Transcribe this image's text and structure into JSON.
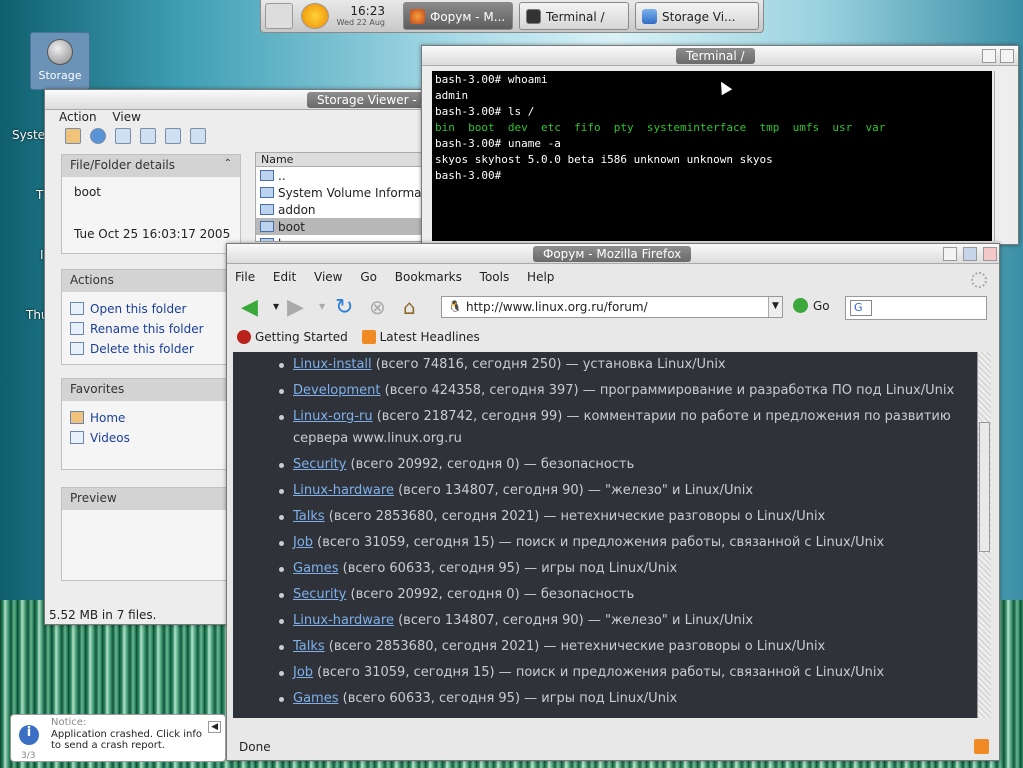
{
  "taskbar": {
    "clock_time": "16:23",
    "clock_date": "Wed 22 Aug",
    "tasks": [
      "Форум - М...",
      "Terminal /",
      "Storage Vi..."
    ]
  },
  "desktop": {
    "storage_icon_label": "Storage",
    "partial_labels": [
      "Syste",
      "T",
      "I",
      "Thu"
    ]
  },
  "storage_viewer": {
    "title": "Storage Viewer - /",
    "menu": [
      "Action",
      "View"
    ],
    "details_header": "File/Folder details",
    "details_name": "boot",
    "details_date": "Tue Oct 25 16:03:17 2005",
    "actions_header": "Actions",
    "actions": [
      "Open this folder",
      "Rename this folder",
      "Delete this folder"
    ],
    "favorites_header": "Favorites",
    "favorites": [
      "Home",
      "Videos"
    ],
    "preview_header": "Preview",
    "list_header": "Name",
    "files": [
      "..",
      "System Volume Informat",
      "addon",
      "boot",
      "b"
    ],
    "status": "5.52 MB in 7 files."
  },
  "terminal": {
    "title": "Terminal /",
    "lines": [
      "bash-3.00# whoami",
      "admin",
      "bash-3.00# ls /",
      "bin  boot  dev  etc  fifo  pty  systeminterface  tmp  umfs  usr  var",
      "bash-3.00# uname -a",
      "skyos skyhost 5.0.0 beta i586 unknown unknown skyos",
      "bash-3.00#"
    ]
  },
  "firefox": {
    "title": "Форум - Mozilla Firefox",
    "menu": [
      "File",
      "Edit",
      "View",
      "Go",
      "Bookmarks",
      "Tools",
      "Help"
    ],
    "url": "http://www.linux.org.ru/forum/",
    "go_label": "Go",
    "bookmarks": [
      "Getting Started",
      "Latest Headlines"
    ],
    "status": "Done",
    "forums": [
      {
        "name": "Linux-install",
        "desc": " (всего 74816, сегодня 250) — установка Linux/Unix"
      },
      {
        "name": "Development",
        "desc": " (всего 424358, сегодня 397) — программирование и разработка ПО под Linux/Unix"
      },
      {
        "name": "Linux-org-ru",
        "desc": " (всего 218742, сегодня 99) — комментарии по работе и предложения по развитию сервера www.linux.org.ru"
      },
      {
        "name": "Security",
        "desc": " (всего 20992, сегодня 0) — безопасность"
      },
      {
        "name": "Linux-hardware",
        "desc": " (всего 134807, сегодня 90) — \"железо\" и Linux/Unix"
      },
      {
        "name": "Talks",
        "desc": " (всего 2853680, сегодня 2021) — нетехнические разговоры о Linux/Unix"
      },
      {
        "name": "Job",
        "desc": " (всего 31059, сегодня 15) — поиск и предложения работы, связанной с Linux/Unix"
      },
      {
        "name": "Games",
        "desc": " (всего 60633, сегодня 95) — игры под Linux/Unix"
      },
      {
        "name": "Security",
        "desc": " (всего 20992, сегодня 0) — безопасность"
      },
      {
        "name": "Linux-hardware",
        "desc": " (всего 134807, сегодня 90) — \"железо\" и Linux/Unix"
      },
      {
        "name": "Talks",
        "desc": " (всего 2853680, сегодня 2021) — нетехнические разговоры о Linux/Unix"
      },
      {
        "name": "Job",
        "desc": " (всего 31059, сегодня 15) — поиск и предложения работы, связанной с Linux/Unix"
      },
      {
        "name": "Games",
        "desc": " (всего 60633, сегодня 95) — игры под Linux/Unix"
      }
    ]
  },
  "notice": {
    "heading": "Notice:",
    "text": "Application crashed. Click info to send a crash report.",
    "counter": "3/3"
  }
}
